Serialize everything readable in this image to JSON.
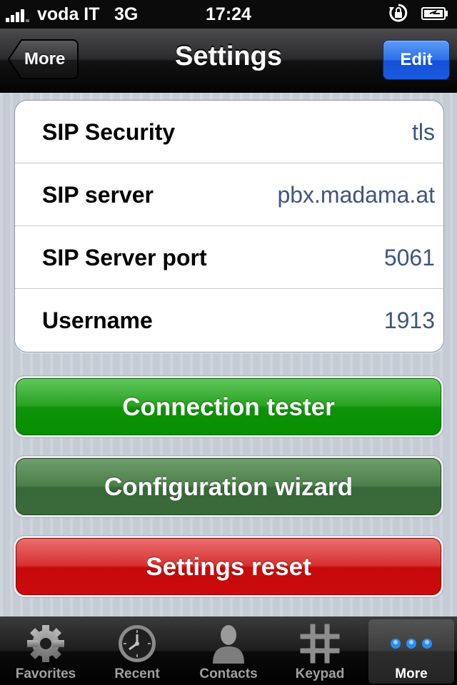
{
  "status_bar": {
    "carrier": "voda IT",
    "network": "3G",
    "time": "17:24",
    "icons": [
      "signal-icon",
      "rotation-lock-icon",
      "battery-icon"
    ]
  },
  "nav": {
    "back_label": "More",
    "title": "Settings",
    "edit_label": "Edit"
  },
  "settings": [
    {
      "label": "SIP Security",
      "value": "tls"
    },
    {
      "label": "SIP server",
      "value": "pbx.madama.at"
    },
    {
      "label": "SIP Server port",
      "value": "5061"
    },
    {
      "label": "Username",
      "value": "1913"
    }
  ],
  "buttons": {
    "connection_tester": "Connection tester",
    "configuration_wizard": "Configuration wizard",
    "settings_reset": "Settings reset"
  },
  "tabs": [
    {
      "label": "Favorites",
      "icon": "gear-icon"
    },
    {
      "label": "Recent",
      "icon": "clock-icon"
    },
    {
      "label": "Contacts",
      "icon": "person-icon"
    },
    {
      "label": "Keypad",
      "icon": "hash-icon"
    },
    {
      "label": "More",
      "icon": "more-dots-icon",
      "selected": true
    }
  ],
  "colors": {
    "edit_button": "#2b6fea",
    "connection_tester": "#27a220",
    "configuration_wizard": "#4d7f4a",
    "settings_reset": "#d63131",
    "value_text": "#3d5581"
  }
}
